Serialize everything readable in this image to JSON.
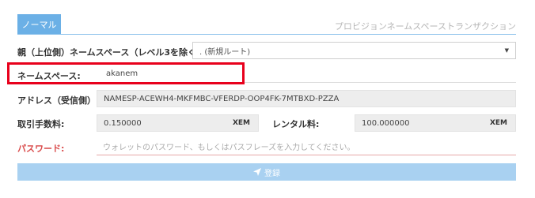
{
  "tabs": {
    "active_label": "ノーマル"
  },
  "header": {
    "title": "プロビジョンネームスペーストランザクション"
  },
  "form": {
    "parent": {
      "label": "親（上位側）ネームスペース（レベル3を除く）:",
      "selected": ". (新規ルート)"
    },
    "namespace": {
      "label": "ネームスペース:",
      "value": "akanem"
    },
    "address": {
      "label": "アドレス（受信側）:",
      "value": "NAMESP-ACEWH4-MKFMBC-VFERDP-OOP4FK-7MTBXD-PZZA"
    },
    "fee": {
      "label": "取引手数料:",
      "value": "0.150000",
      "unit": "XEM"
    },
    "rental": {
      "label": "レンタル料:",
      "value": "100.000000",
      "unit": "XEM"
    },
    "password": {
      "label": "パスワード:",
      "placeholder": "ウォレットのパスワード、もしくはパスフレーズを入力してください。"
    }
  },
  "submit": {
    "label": "登録",
    "icon": "send-icon"
  },
  "colors": {
    "accent": "#6bb0e6",
    "submit_bg": "#a9d1f1",
    "highlight": "#e8001c",
    "password_label": "#d94a4a"
  }
}
